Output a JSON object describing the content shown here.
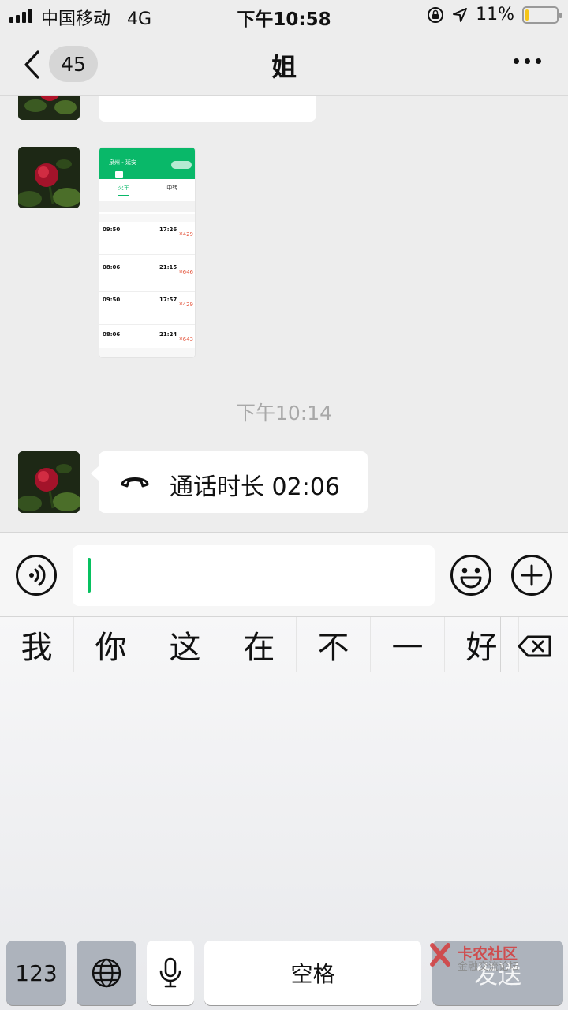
{
  "status_bar": {
    "carrier": "中国移动",
    "network": "4G",
    "time": "下午10:58",
    "battery_text": "11%",
    "battery_level": 0.11
  },
  "nav": {
    "unread_count": "45",
    "title": "姐",
    "icons": [
      "chevron-left-icon",
      "more-icon"
    ]
  },
  "chat": {
    "timestamp": "下午10:14",
    "messages": [
      {
        "type": "text",
        "sender": "contact",
        "text": "",
        "cut_off": true
      },
      {
        "type": "image",
        "sender": "contact",
        "thumbnail": {
          "route": "泉州 - 延安",
          "tabs": [
            "火车",
            "中转"
          ],
          "trains": [
            {
              "depart": "09:50",
              "arrive": "17:26",
              "price": "¥429"
            },
            {
              "depart": "08:06",
              "arrive": "21:15",
              "price": "¥646"
            },
            {
              "depart": "09:50",
              "arrive": "17:57",
              "price": "¥429"
            },
            {
              "depart": "08:06",
              "arrive": "21:24",
              "price": "¥643"
            }
          ]
        }
      },
      {
        "type": "call",
        "sender": "contact",
        "text": "通话时长 02:06"
      }
    ]
  },
  "input_bar": {
    "value": "",
    "icons": [
      "voice-icon",
      "emoji-icon",
      "plus-icon"
    ]
  },
  "keyboard": {
    "candidates": [
      "我",
      "你",
      "这",
      "在",
      "不",
      "一",
      "好"
    ],
    "keys": {
      "numbers": "123",
      "space": "空格",
      "send": "发送"
    },
    "icons": [
      "backspace-icon",
      "globe-icon",
      "microphone-icon"
    ]
  },
  "watermark": {
    "title": "卡农社区",
    "subtitle": "金融交流论坛"
  }
}
